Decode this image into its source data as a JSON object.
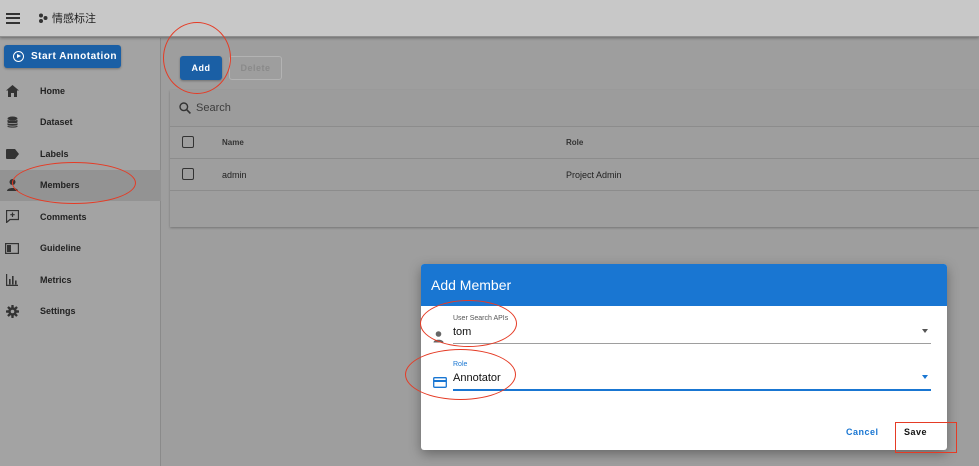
{
  "appbar": {
    "title": "情感标注"
  },
  "sidebar": {
    "start_button": "Start Annotation",
    "items": [
      {
        "label": "Home",
        "icon": "home-icon"
      },
      {
        "label": "Dataset",
        "icon": "database-icon"
      },
      {
        "label": "Labels",
        "icon": "label-icon"
      },
      {
        "label": "Members",
        "icon": "account-icon",
        "active": true
      },
      {
        "label": "Comments",
        "icon": "comment-icon"
      },
      {
        "label": "Guideline",
        "icon": "book-icon"
      },
      {
        "label": "Metrics",
        "icon": "chart-icon"
      },
      {
        "label": "Settings",
        "icon": "gear-icon"
      }
    ]
  },
  "toolbar": {
    "add_label": "Add",
    "delete_label": "Delete"
  },
  "search": {
    "placeholder": "Search"
  },
  "table": {
    "headers": [
      "Name",
      "Role"
    ],
    "rows": [
      {
        "name": "admin",
        "role": "Project Admin"
      }
    ]
  },
  "dialog": {
    "title": "Add Member",
    "user_field": {
      "label": "User Search APIs",
      "value": "tom"
    },
    "role_field": {
      "label": "Role",
      "value": "Annotator"
    },
    "cancel_label": "Cancel",
    "save_label": "Save"
  },
  "colors": {
    "primary": "#1976d2",
    "dark_primary": "#1a5fa5",
    "annotation_red": "#e53b25"
  }
}
